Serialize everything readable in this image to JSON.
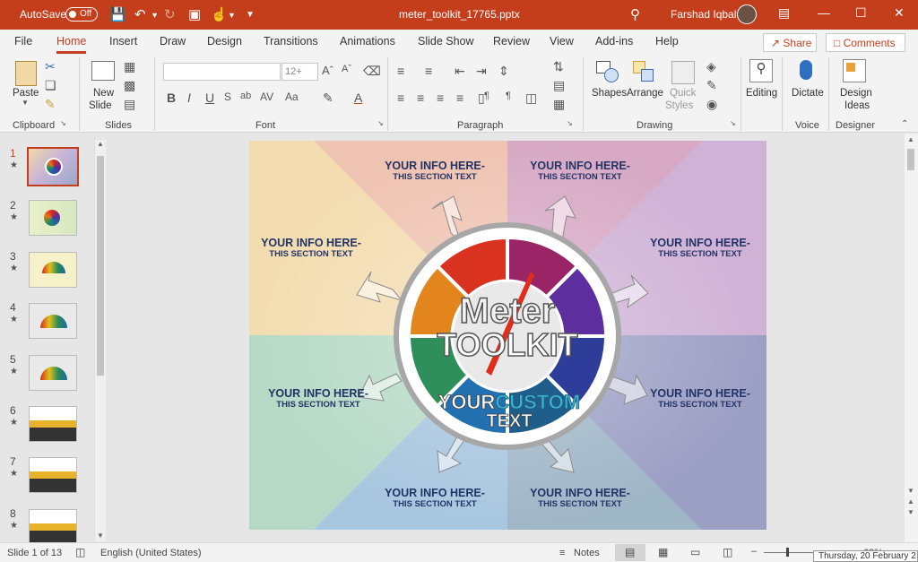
{
  "titlebar": {
    "autosave_label": "AutoSave",
    "autosave_state": "Off",
    "document_title": "meter_toolkit_17765.pptx",
    "user_name": "Farshad Iqbal",
    "accent_color": "#c43e1c"
  },
  "ribbon_tabs": [
    "File",
    "Home",
    "Insert",
    "Draw",
    "Design",
    "Transitions",
    "Animations",
    "Slide Show",
    "Review",
    "View",
    "Add-ins",
    "Help"
  ],
  "active_tab": "Home",
  "share_label": "Share",
  "comments_label": "Comments",
  "ribbon": {
    "clipboard": {
      "label": "Clipboard",
      "paste": "Paste"
    },
    "slides": {
      "label": "Slides",
      "new_slide_line1": "New",
      "new_slide_line2": "Slide"
    },
    "font": {
      "label": "Font",
      "size_placeholder": "12+"
    },
    "paragraph": {
      "label": "Paragraph"
    },
    "drawing": {
      "label": "Drawing",
      "shapes": "Shapes",
      "arrange": "Arrange",
      "quick_styles_line1": "Quick",
      "quick_styles_line2": "Styles"
    },
    "editing": {
      "label": "Editing"
    },
    "voice": {
      "label": "Voice",
      "dictate": "Dictate"
    },
    "designer": {
      "label": "Designer",
      "design_ideas_line1": "Design",
      "design_ideas_line2": "Ideas"
    }
  },
  "thumbnails": [
    {
      "num": "1",
      "active": true
    },
    {
      "num": "2",
      "active": false
    },
    {
      "num": "3",
      "active": false
    },
    {
      "num": "4",
      "active": false
    },
    {
      "num": "5",
      "active": false
    },
    {
      "num": "6",
      "active": false
    },
    {
      "num": "7",
      "active": false
    },
    {
      "num": "8",
      "active": false
    }
  ],
  "slide": {
    "title_line1": "Meter",
    "title_line2": "TOOLKIT",
    "custom_word1": "YOUR",
    "custom_word2": "CUSTOM",
    "custom_word3": "TEXT",
    "info_heading": "YOUR INFO HERE-",
    "info_sub": "THIS SECTION TEXT"
  },
  "statusbar": {
    "slide_count": "Slide 1 of 13",
    "language": "English (United States)",
    "notes_label": "Notes",
    "zoom": "68%",
    "tooltip": "Thursday, 20 February 2"
  }
}
